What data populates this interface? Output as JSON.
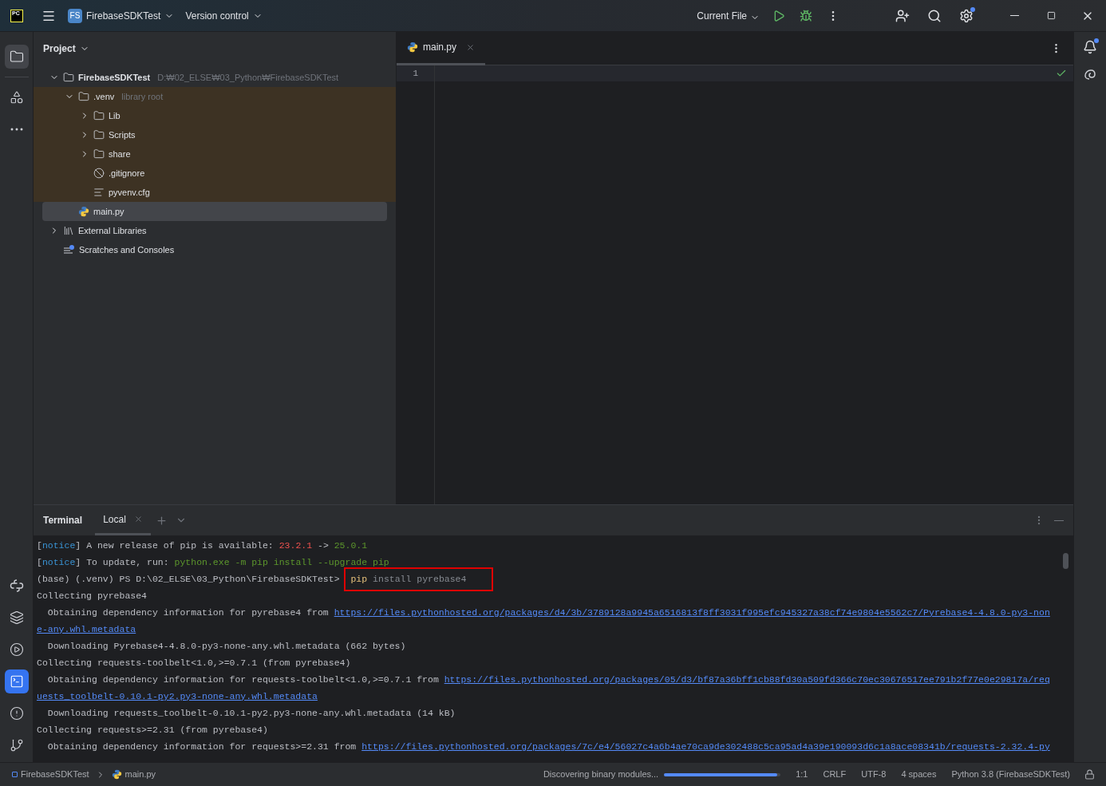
{
  "title_bar": {
    "app_badge": "PC",
    "project_badge": "FS",
    "project": "FirebaseSDKTest",
    "vcs": "Version control",
    "run_config": "Current File",
    "settings_badge": true
  },
  "left_toolbar": {
    "top": [
      {
        "kind": "folder",
        "selected": true
      },
      {
        "kind": "structure",
        "selected": false
      },
      {
        "kind": "more",
        "selected": false
      }
    ],
    "bottom": [
      {
        "kind": "python",
        "selected": false
      },
      {
        "kind": "layers",
        "selected": false
      },
      {
        "kind": "services",
        "selected": false
      },
      {
        "kind": "terminal",
        "selected": true
      },
      {
        "kind": "problems",
        "selected": false
      },
      {
        "kind": "git",
        "selected": false
      }
    ]
  },
  "project_panel": {
    "title": "Project",
    "tree": [
      {
        "name": "FirebaseSDKTest",
        "hint": "D:₩02_ELSE₩03_Python₩FirebaseSDKTest",
        "kind": "folder",
        "bold": true,
        "expanded": true,
        "selected": false,
        "children": [
          {
            "name": ".venv",
            "hint": "library root",
            "kind": "folder",
            "library_root": true,
            "expanded": true,
            "selected": false,
            "children": [
              {
                "name": "Lib",
                "kind": "folder",
                "expanded": false,
                "selected": false
              },
              {
                "name": "Scripts",
                "kind": "folder",
                "expanded": false,
                "selected": false
              },
              {
                "name": "share",
                "kind": "folder",
                "expanded": false,
                "selected": false
              },
              {
                "name": ".gitignore",
                "kind": "ignore",
                "selected": false
              },
              {
                "name": "pyvenv.cfg",
                "kind": "text",
                "selected": false
              }
            ]
          },
          {
            "name": "main.py",
            "kind": "python",
            "selected": true
          }
        ]
      },
      {
        "name": "External Libraries",
        "kind": "libraries",
        "expanded": false,
        "selected": false
      },
      {
        "name": "Scratches and Consoles",
        "kind": "scratches",
        "selected": false
      }
    ]
  },
  "editor": {
    "tabs": [
      {
        "label": "main.py",
        "selected": true
      }
    ],
    "line_numbers": [
      "1"
    ],
    "inspection_ok": true
  },
  "right_toolbar": {
    "notification_badge": true
  },
  "terminal": {
    "title": "Terminal",
    "tabs": [
      {
        "label": "Local",
        "selected": true
      }
    ],
    "rows": [
      [
        {
          "t": "[",
          "kind": "plain"
        },
        {
          "t": "notice",
          "kind": "notice"
        },
        {
          "t": "] A new release of pip is available: ",
          "kind": "plain"
        },
        {
          "t": "23.2.1",
          "kind": "red"
        },
        {
          "t": " -> ",
          "kind": "plain"
        },
        {
          "t": "25.0.1",
          "kind": "green"
        }
      ],
      [
        {
          "t": "[",
          "kind": "plain"
        },
        {
          "t": "notice",
          "kind": "notice"
        },
        {
          "t": "] To update, run: ",
          "kind": "plain"
        },
        {
          "t": "python.exe -m pip install --upgrade pip",
          "kind": "green"
        }
      ],
      [
        {
          "t": "(base) (.venv) PS D:\\02_ELSE\\03_Python\\FirebaseSDKTest> ",
          "kind": "plain"
        },
        {
          "t": "pip",
          "kind": "command",
          "highlighted": true
        },
        {
          "t": " install pyrebase4",
          "kind": "dim",
          "highlighted": true
        }
      ],
      [
        {
          "t": "Collecting pyrebase4",
          "kind": "plain"
        }
      ],
      [
        {
          "t": "  Obtaining dependency information for pyrebase4 from ",
          "kind": "plain"
        },
        {
          "t": "https://files.pythonhosted.org/packages/d4/3b/3789128a9945a6516813f8ff3031f995efc945327a38cf74e9804e5562c7/Pyrebase4-4.8.0-py3-non",
          "kind": "link"
        }
      ],
      [
        {
          "t": "e-any.whl.metadata",
          "kind": "link"
        }
      ],
      [
        {
          "t": "  Downloading Pyrebase4-4.8.0-py3-none-any.whl.metadata (662 bytes)",
          "kind": "plain"
        }
      ],
      [
        {
          "t": "Collecting requests-toolbelt<1.0,>=0.7.1 (from pyrebase4)",
          "kind": "plain"
        }
      ],
      [
        {
          "t": "  Obtaining dependency information for requests-toolbelt<1.0,>=0.7.1 from ",
          "kind": "plain"
        },
        {
          "t": "https://files.pythonhosted.org/packages/05/d3/bf87a36bff1cb88fd30a509fd366c70ec30676517ee791b2f77e0e29817a/req",
          "kind": "link"
        }
      ],
      [
        {
          "t": "uests_toolbelt-0.10.1-py2.py3-none-any.whl.metadata",
          "kind": "link"
        }
      ],
      [
        {
          "t": "  Downloading requests_toolbelt-0.10.1-py2.py3-none-any.whl.metadata (14 kB)",
          "kind": "plain"
        }
      ],
      [
        {
          "t": "Collecting requests>=2.31 (from pyrebase4)",
          "kind": "plain"
        }
      ],
      [
        {
          "t": "  Obtaining dependency information for requests>=2.31 from ",
          "kind": "plain"
        },
        {
          "t": "https://files.pythonhosted.org/packages/7c/e4/56027c4a6b4ae70ca9de302488c5ca95ad4a39e190093d6c1a8ace08341b/requests-2.32.4-py",
          "kind": "link"
        }
      ]
    ]
  },
  "status_bar": {
    "breadcrumbs": [
      {
        "label": "FirebaseSDKTest",
        "kind": "module"
      },
      {
        "label": "main.py",
        "kind": "python"
      }
    ],
    "task": "Discovering binary modules...",
    "level": 0.97,
    "items": [
      "1:1",
      "CRLF",
      "UTF-8",
      "4 spaces",
      "Python 3.8 (FirebaseSDKTest)"
    ]
  }
}
